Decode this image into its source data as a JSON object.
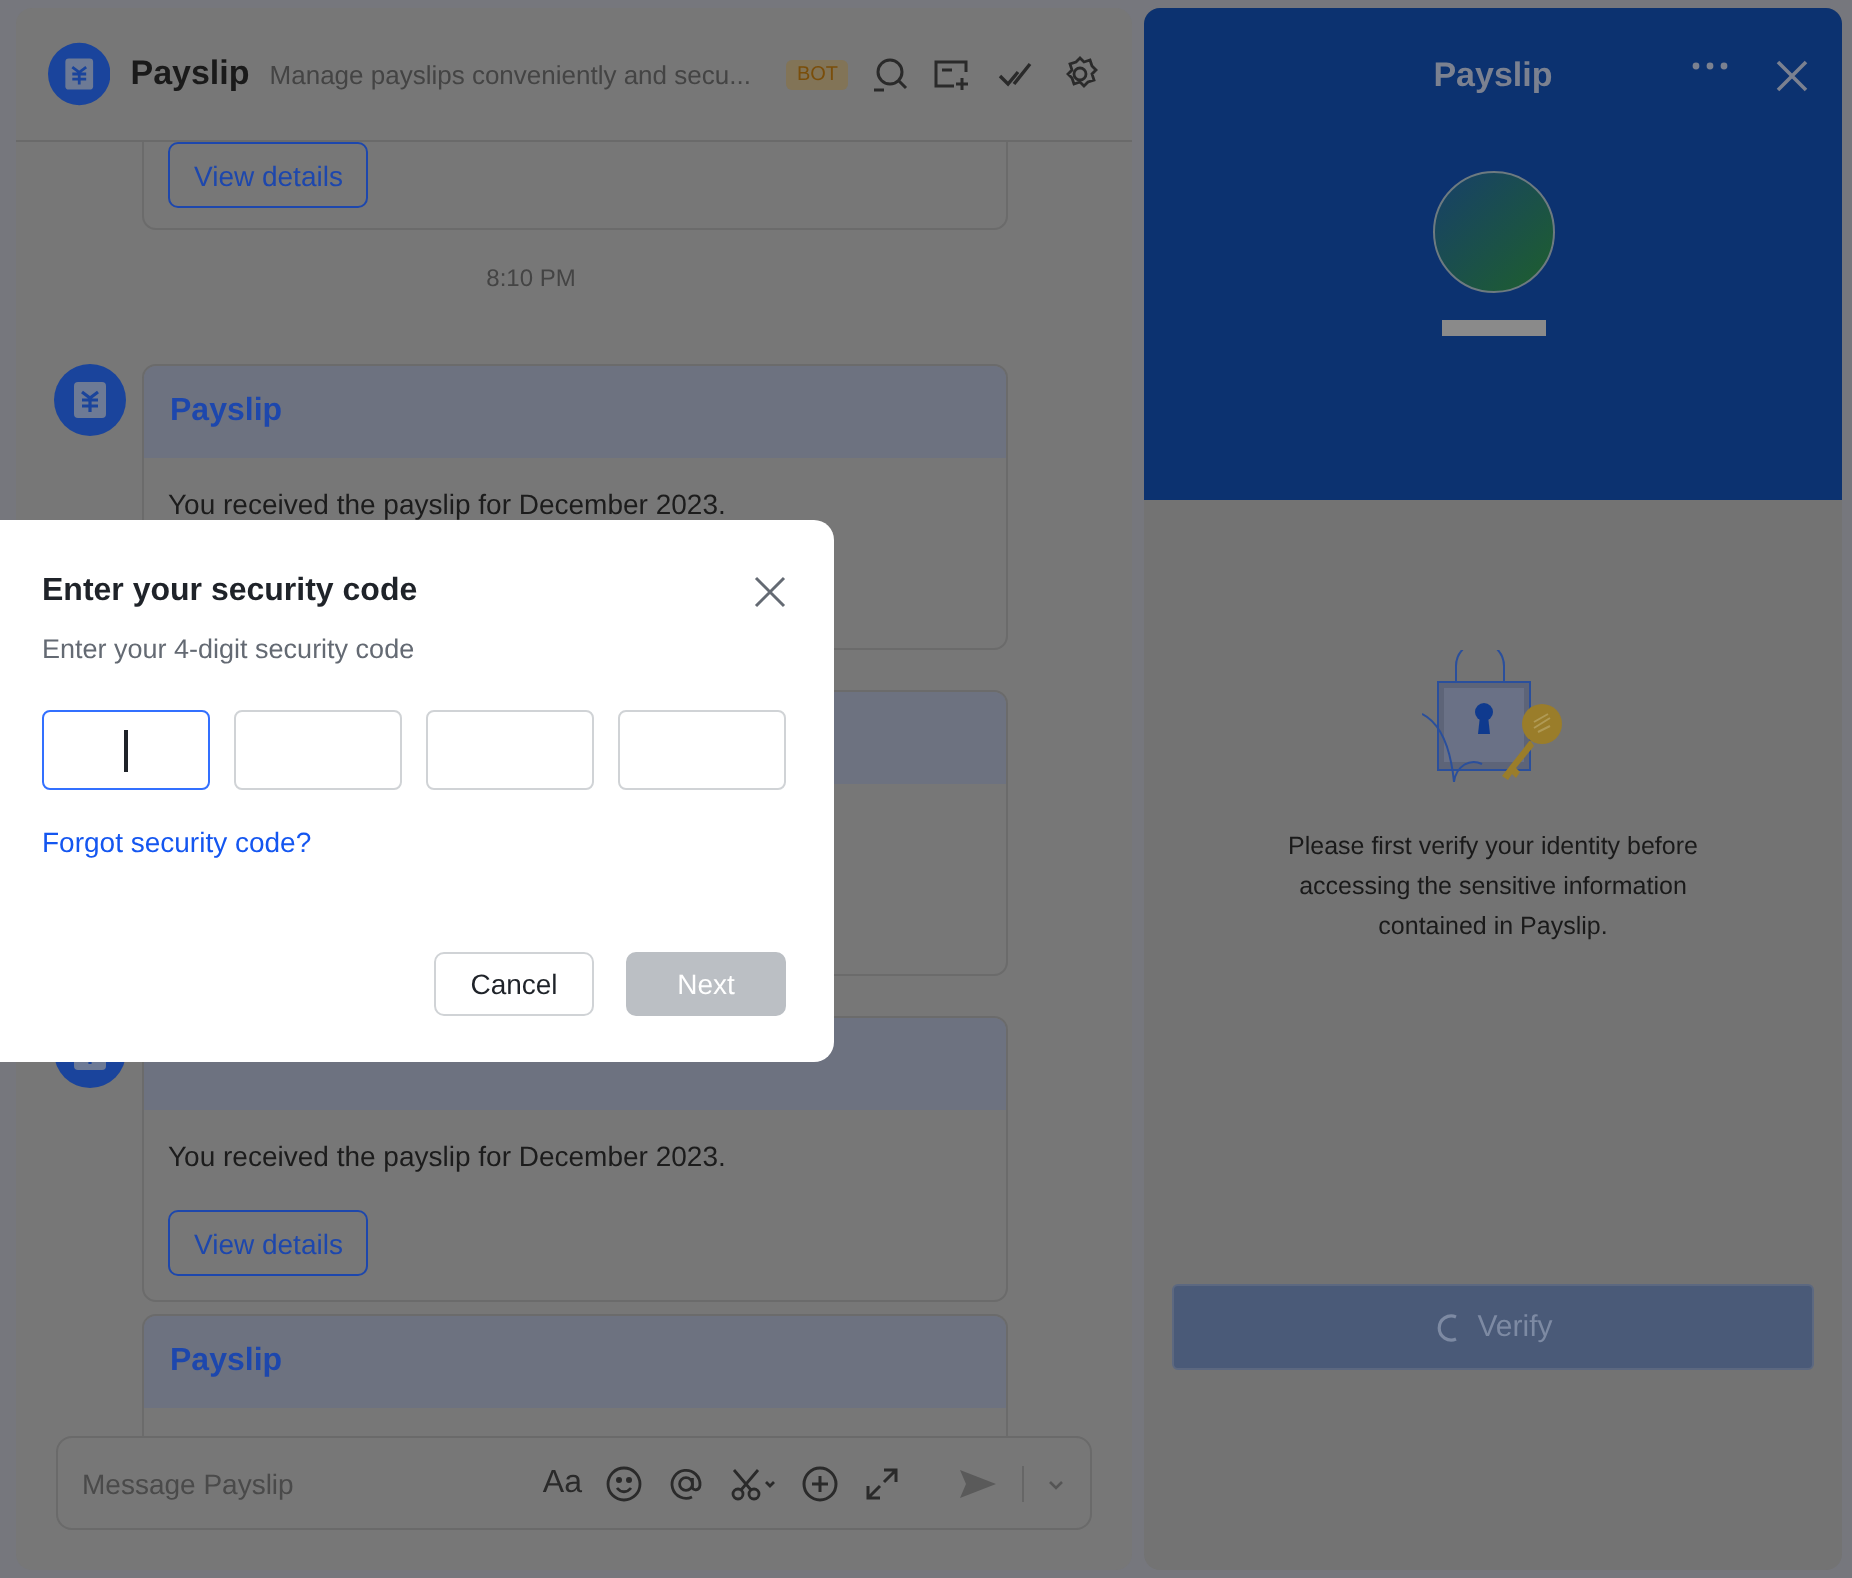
{
  "chat": {
    "header": {
      "title": "Payslip",
      "description": "Manage payslips conveniently and secu...",
      "badge": "BOT"
    },
    "messages": [
      {
        "kind": "tail",
        "button": "View details"
      },
      {
        "kind": "time",
        "text": "8:10 PM"
      },
      {
        "kind": "card",
        "avatar": true,
        "title": "Payslip",
        "body": "You received the payslip for December 2023."
      },
      {
        "kind": "card"
      },
      {
        "kind": "card",
        "avatar": true,
        "body": "You received the payslip for December 2023.",
        "button": "View details"
      },
      {
        "kind": "head",
        "title": "Payslip"
      }
    ],
    "composer": {
      "placeholder": "Message Payslip",
      "format_icon": "Aa"
    }
  },
  "side_panel": {
    "title": "Payslip",
    "message": "Please first verify your identity before accessing the sensitive information contained in Payslip.",
    "button": {
      "label": "Verify",
      "loading": true
    }
  },
  "dialog": {
    "title": "Enter your security code",
    "subtitle": "Enter your 4-digit security code",
    "code_fields": [
      {
        "focused": true
      },
      {
        "focused": false
      },
      {
        "focused": false
      },
      {
        "focused": false
      }
    ],
    "link": "Forgot security code?",
    "buttons": [
      {
        "label": "Cancel",
        "kind": "secondary",
        "disabled": false
      },
      {
        "label": "Next",
        "kind": "primary",
        "disabled": true
      }
    ]
  }
}
